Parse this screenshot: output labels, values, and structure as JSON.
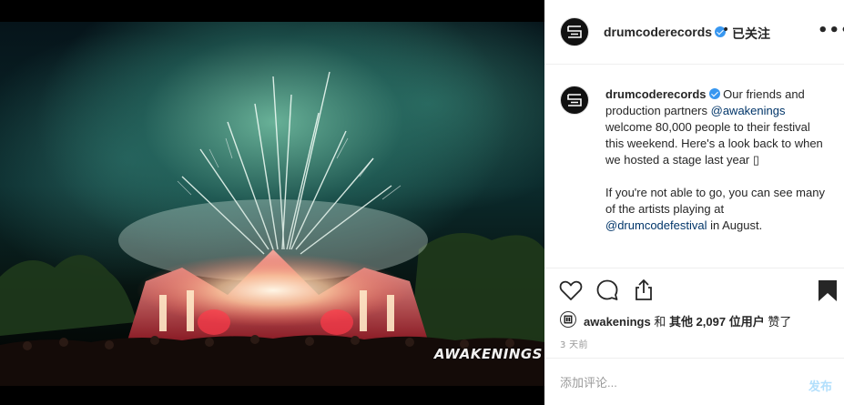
{
  "header": {
    "username": "drumcoderecords",
    "separator": "•",
    "follow_label": "已关注",
    "more_label": "•••"
  },
  "photo": {
    "watermark": "AWAKENINGS"
  },
  "caption": {
    "username": "drumcoderecords",
    "text_1a": "Our friends and production partners ",
    "mention_1": "@awakenings",
    "text_1b": " welcome 80,000 people to their festival this weekend. Here's a look back to when we hosted a stage last year ",
    "emoji": "▯",
    "text_2a": "If you're not able to go, you can see many of the artists playing at ",
    "mention_2": "@drumcodefestival",
    "text_2b": " in August."
  },
  "actions": {
    "like_icon": "heart-icon",
    "comment_icon": "comment-icon",
    "share_icon": "share-icon",
    "save_icon": "bookmark-icon"
  },
  "likes": {
    "user": "awakenings",
    "and": " 和 ",
    "others": "其他 2,097 位用户",
    "liked": " 赞了"
  },
  "time": "3 天前",
  "comment": {
    "placeholder": "添加评论...",
    "post_label": "发布"
  },
  "colors": {
    "verified": "#3897f0",
    "link": "#003569",
    "post_disabled": "#b2dffc"
  }
}
